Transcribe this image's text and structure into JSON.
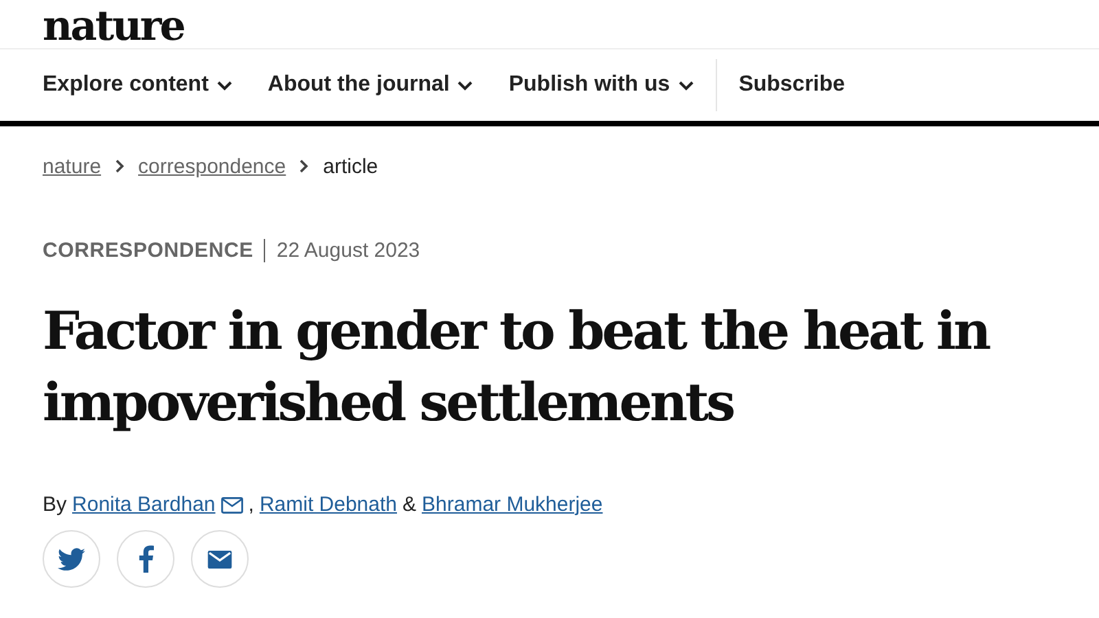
{
  "logo": "nature",
  "nav": [
    {
      "label": "Explore content",
      "dropdown": true
    },
    {
      "label": "About the journal",
      "dropdown": true
    },
    {
      "label": "Publish with us",
      "dropdown": true
    },
    {
      "label": "Subscribe",
      "dropdown": false
    }
  ],
  "breadcrumb": [
    {
      "label": "nature",
      "link": true
    },
    {
      "label": "correspondence",
      "link": true
    },
    {
      "label": "article",
      "link": false
    }
  ],
  "article_type": "CORRESPONDENCE",
  "date": "22 August 2023",
  "title": "Factor in gender to beat the heat in impoverished settlements",
  "byline": {
    "prefix": "By",
    "authors": [
      {
        "name": "Ronita Bardhan",
        "contact": true,
        "after": ","
      },
      {
        "name": "Ramit Debnath",
        "contact": false,
        "after": "&"
      },
      {
        "name": "Bhramar Mukherjee",
        "contact": false
      }
    ]
  },
  "share": [
    {
      "kind": "twitter"
    },
    {
      "kind": "facebook"
    },
    {
      "kind": "email"
    }
  ]
}
